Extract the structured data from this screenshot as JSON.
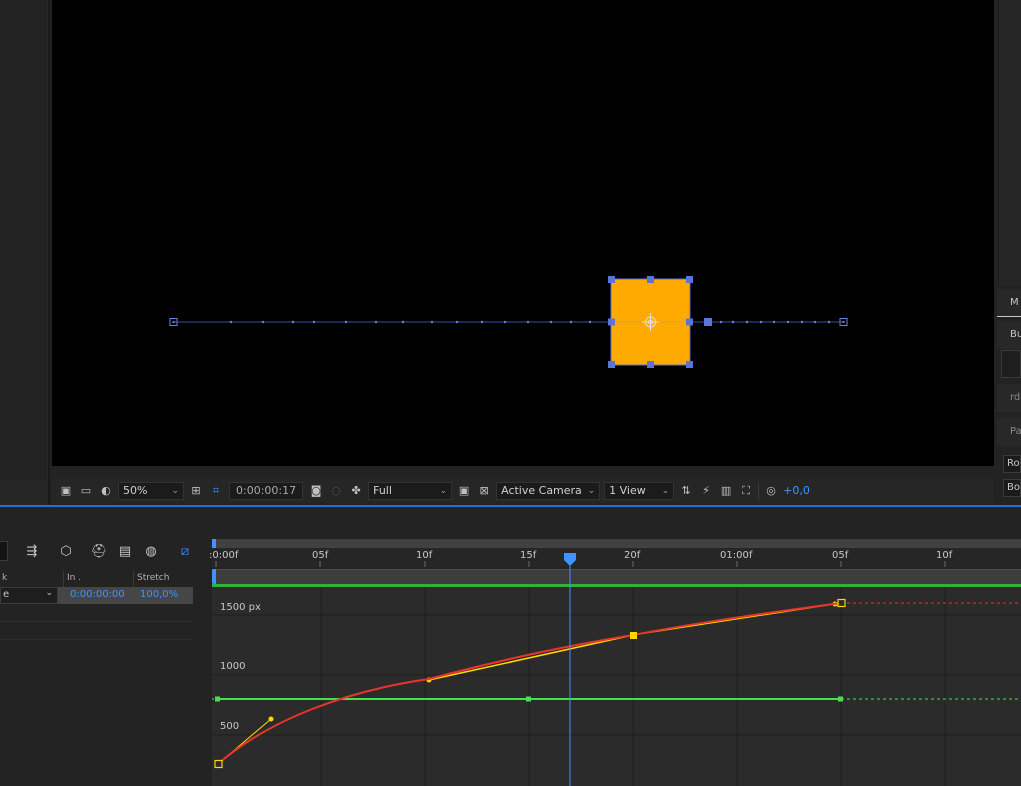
{
  "viewer_toolbar": {
    "zoom": "50%",
    "timecode": "0:00:00:17",
    "resolution": "Full",
    "camera": "Active Camera",
    "view": "1 View",
    "exposure": "+0,0",
    "icons": [
      "region-of-interest-icon",
      "monitor-icon",
      "mask-visibility-icon",
      "grid-icon",
      "mask-path-icon",
      "camera-snapshot-icon",
      "show-snapshot-icon",
      "channel-icon",
      "toggle-transparency-grid-icon",
      "fast-preview-icon",
      "timeline-icon",
      "comp-flowchart-icon",
      "reset-exposure-icon"
    ]
  },
  "right_panel": {
    "items": [
      "M",
      "Bu",
      "rd",
      "Pa"
    ],
    "buttons": [
      "Ro",
      "Bo"
    ]
  },
  "timeline": {
    "columns": {
      "in": "In",
      "in_suffix": ".",
      "stretch": "Stretch",
      "left_stub": "k"
    },
    "row": {
      "mode_stub": "e",
      "in_value": "0:00:00:00",
      "stretch_value": "100,0%"
    },
    "ruler_labels": [
      ":0:00f",
      "05f",
      "10f",
      "15f",
      "20f",
      "01:00f",
      "05f",
      "10f"
    ],
    "graph_labels": [
      "1500 px",
      "1000",
      "500"
    ]
  },
  "colors": {
    "accent": "#2d6ad6",
    "layer_fill": "#ffaa00",
    "handle_blue": "#5b74d6",
    "graph_red": "#e8352b",
    "graph_green": "#49e04f",
    "graph_yellow": "#ffd800",
    "exposure_blue": "#3f93ff"
  }
}
